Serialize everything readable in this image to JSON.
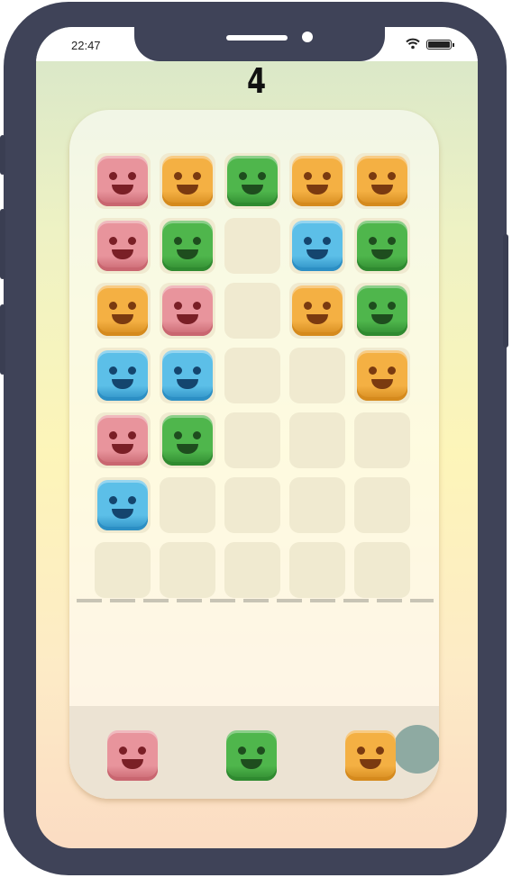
{
  "status_bar": {
    "time": "22:47"
  },
  "score": "4",
  "colors": {
    "pink": {
      "face": "#e8949c",
      "dark": "#c96670",
      "feature": "#7a1f26"
    },
    "orange": {
      "face": "#f4b043",
      "dark": "#d58a1d",
      "feature": "#7a3a10"
    },
    "green": {
      "face": "#4fb64c",
      "dark": "#2f8a30",
      "feature": "#1e4d1e"
    },
    "blue": {
      "face": "#5cbfe8",
      "dark": "#2c8fc4",
      "feature": "#14456e"
    }
  },
  "board": {
    "columns": 5,
    "rows": 7,
    "cells": [
      [
        "pink",
        "orange",
        "green",
        "orange",
        "orange"
      ],
      [
        "pink",
        "green",
        "",
        "blue",
        "green"
      ],
      [
        "orange",
        "pink",
        "",
        "orange",
        "green"
      ],
      [
        "blue",
        "blue",
        "",
        "",
        "orange"
      ],
      [
        "pink",
        "green",
        "",
        "",
        ""
      ],
      [
        "blue",
        "",
        "",
        "",
        ""
      ],
      [
        "",
        "",
        "",
        "",
        ""
      ]
    ]
  },
  "tray": {
    "pieces": [
      "pink",
      "green",
      "orange"
    ]
  }
}
